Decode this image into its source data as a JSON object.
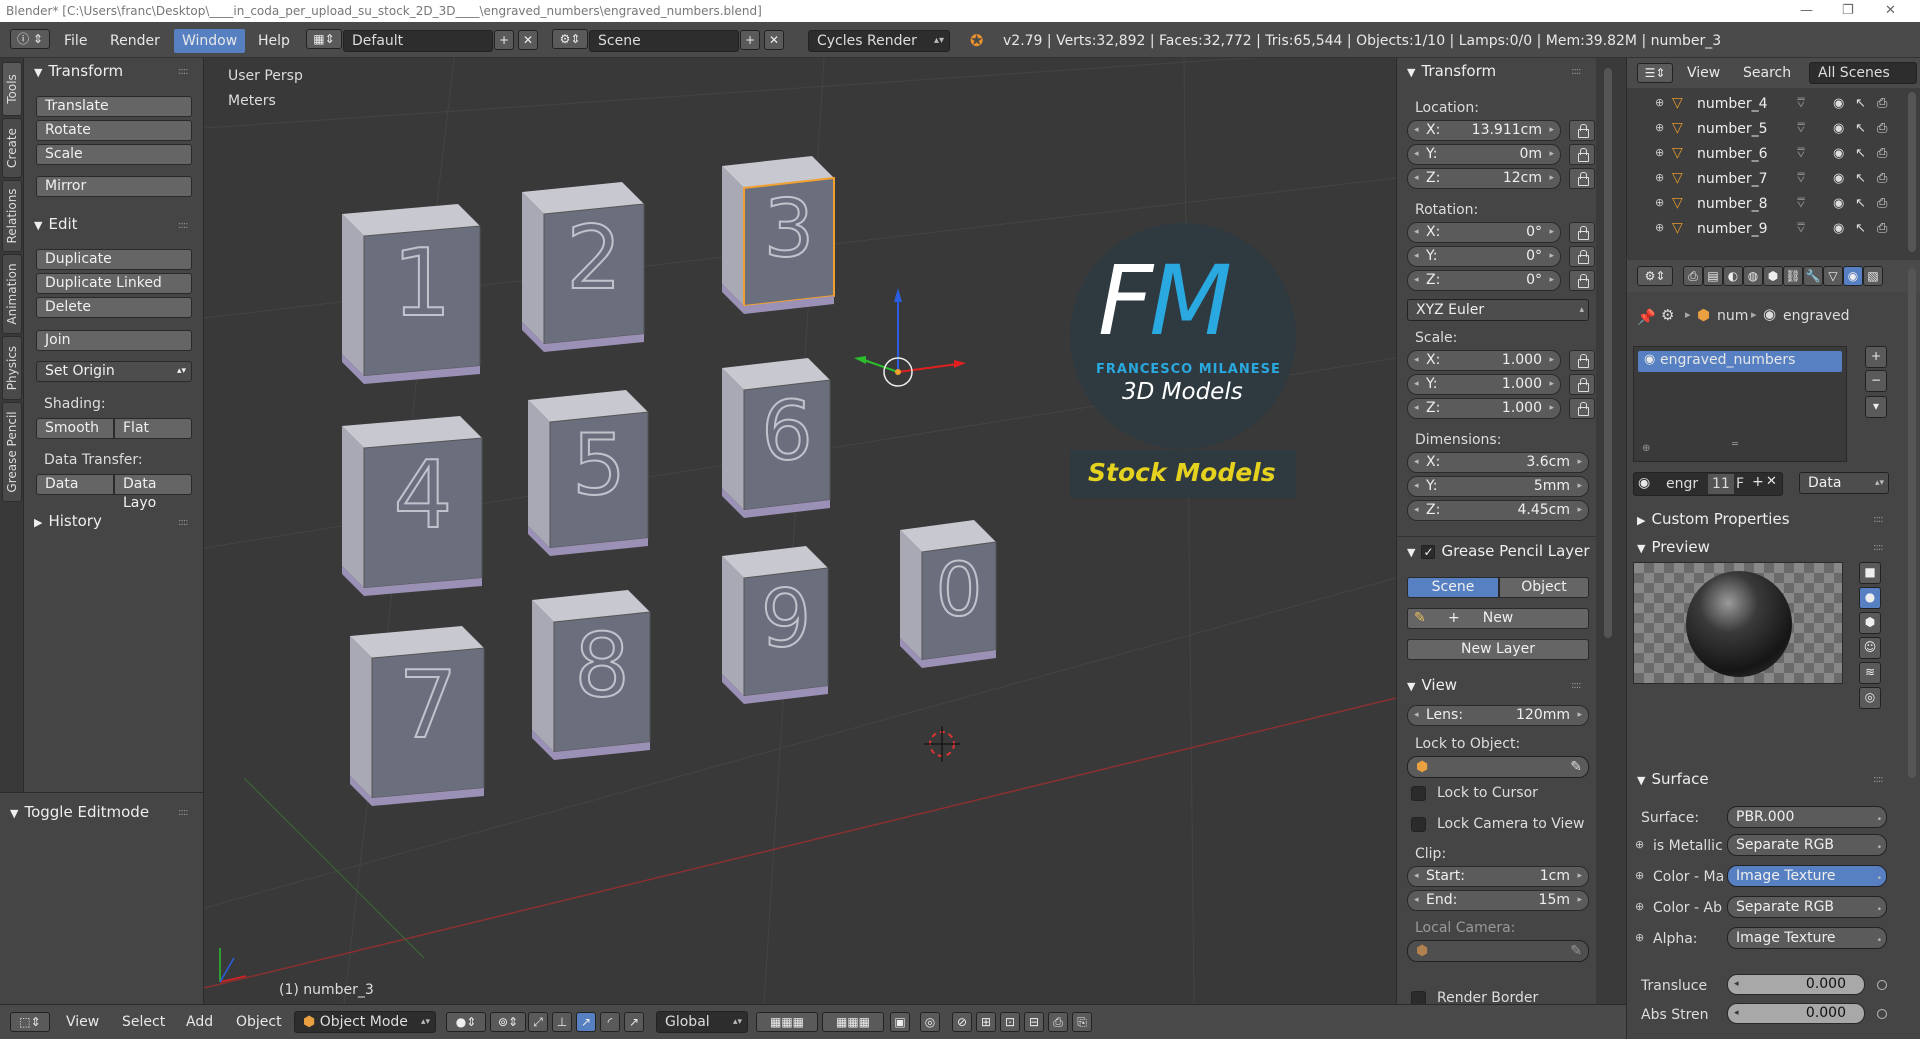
{
  "window": {
    "title": "Blender* [C:\\Users\\franc\\Desktop\\____in_coda_per_upload_su_stock_2D_3D____\\engraved_numbers\\engraved_numbers.blend]",
    "minimize": "—",
    "maximize": "❐",
    "close": "✕"
  },
  "menu": {
    "file": "File",
    "render": "Render",
    "window": "Window",
    "help": "Help",
    "layout": "Default",
    "scene": "Scene",
    "engine": "Cycles Render",
    "stats": "v2.79 | Verts:32,892 | Faces:32,772 | Tris:65,544 | Objects:1/10 | Lamps:0/0 | Mem:39.82M | number_3"
  },
  "vtabs": [
    "Tools",
    "Create",
    "Relations",
    "Animation",
    "Physics",
    "Grease Pencil"
  ],
  "toolshelf": {
    "transform_header": "Transform",
    "translate": "Translate",
    "rotate": "Rotate",
    "scale": "Scale",
    "mirror": "Mirror",
    "edit_header": "Edit",
    "duplicate": "Duplicate",
    "duplicate_linked": "Duplicate Linked",
    "delete": "Delete",
    "join": "Join",
    "set_origin": "Set Origin",
    "shading_label": "Shading:",
    "smooth": "Smooth",
    "flat": "Flat",
    "data_transfer_label": "Data Transfer:",
    "data": "Data",
    "data_layout": "Data Layo",
    "history_header": "History",
    "toggle_editmode": "Toggle Editmode"
  },
  "viewport": {
    "view_name": "User Persp",
    "units": "Meters",
    "selected_object": "(1) number_3",
    "logo_letters": "FM",
    "logo_name": "FRANCESCO MILANESE",
    "logo_sub": "3D Models",
    "logo_banner": "Stock Models",
    "tiles": [
      "1",
      "2",
      "3",
      "4",
      "5",
      "6",
      "7",
      "8",
      "9",
      "0"
    ],
    "colors": {
      "tile_face": "#6b6f7d",
      "tile_top": "#c8c8d0",
      "selection": "#f0a030"
    }
  },
  "npanel": {
    "transform_header": "Transform",
    "location_label": "Location:",
    "loc_x_label": "X:",
    "loc_x": "13.911cm",
    "loc_y_label": "Y:",
    "loc_y": "0m",
    "loc_z_label": "Z:",
    "loc_z": "12cm",
    "rotation_label": "Rotation:",
    "rot_x_label": "X:",
    "rot_x": "0°",
    "rot_y_label": "Y:",
    "rot_y": "0°",
    "rot_z_label": "Z:",
    "rot_z": "0°",
    "rotation_mode": "XYZ Euler",
    "scale_label": "Scale:",
    "scale_x_label": "X:",
    "scale_x": "1.000",
    "scale_y_label": "Y:",
    "scale_y": "1.000",
    "scale_z_label": "Z:",
    "scale_z": "1.000",
    "dimensions_label": "Dimensions:",
    "dim_x_label": "X:",
    "dim_x": "3.6cm",
    "dim_y_label": "Y:",
    "dim_y": "5mm",
    "dim_z_label": "Z:",
    "dim_z": "4.45cm",
    "grease_header": "Grease Pencil Layer",
    "scene_tab": "Scene",
    "object_tab": "Object",
    "new": "New",
    "new_layer": "New Layer",
    "view_header": "View",
    "lens_label": "Lens:",
    "lens": "120mm",
    "lock_object_label": "Lock to Object:",
    "lock_cursor": "Lock to Cursor",
    "lock_camera": "Lock Camera to View",
    "clip_label": "Clip:",
    "clip_start_label": "Start:",
    "clip_start": "1cm",
    "clip_end_label": "End:",
    "clip_end": "15m",
    "local_camera_label": "Local Camera:",
    "render_border": "Render Border"
  },
  "outliner": {
    "view": "View",
    "search": "Search",
    "filter": "All Scenes",
    "items": [
      "number_4",
      "number_5",
      "number_6",
      "number_7",
      "number_8",
      "number_9"
    ]
  },
  "properties": {
    "crumb_obj": "num",
    "crumb_mat": "engraved",
    "material_slot": "engraved_numbers",
    "mat_name": "engr",
    "users": "11",
    "fake": "F",
    "link": "Data",
    "custom_props": "Custom Properties",
    "preview": "Preview",
    "surface_header": "Surface",
    "surface_label": "Surface:",
    "surface_value": "PBR.000",
    "inputs": [
      {
        "label": "is Metallic",
        "value": "Separate RGB",
        "active": false
      },
      {
        "label": "Color - Ma",
        "value": "Image Texture",
        "active": true
      },
      {
        "label": "Color - Ab",
        "value": "Separate RGB",
        "active": false
      },
      {
        "label": "Alpha:",
        "value": "Image Texture",
        "active": false
      }
    ],
    "translucence_label": "Transluce",
    "translucence": "0.000",
    "abs_strength_label": "Abs Stren",
    "abs_strength": "0.000"
  },
  "bottombar": {
    "view": "View",
    "select": "Select",
    "add": "Add",
    "object": "Object",
    "mode": "Object Mode",
    "orientation": "Global"
  }
}
